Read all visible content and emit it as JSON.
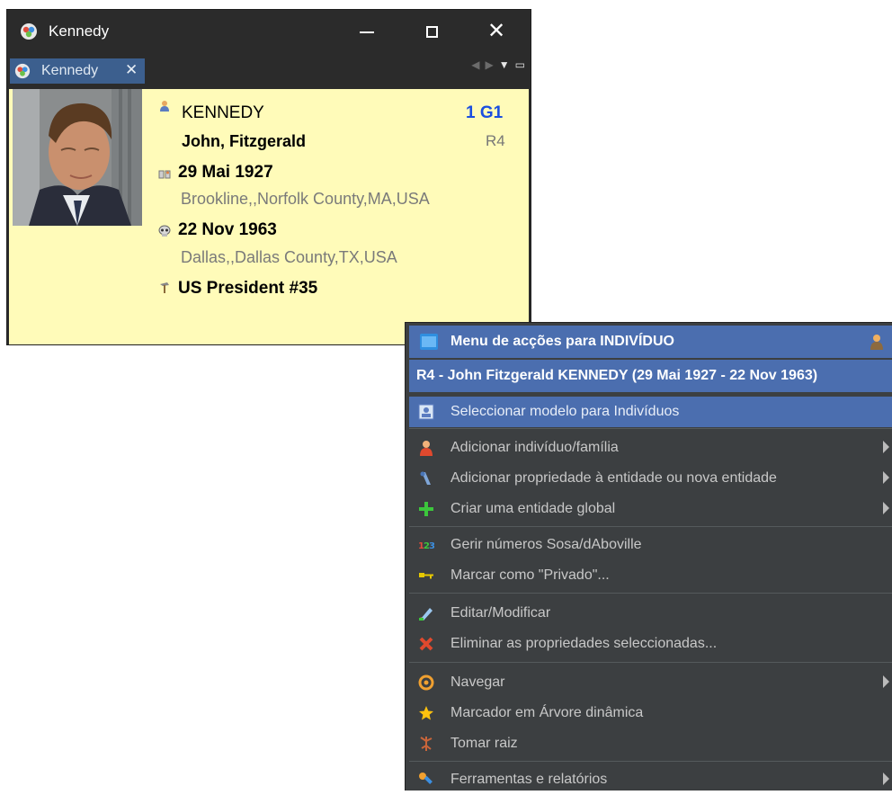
{
  "window": {
    "title": "Kennedy",
    "tab_label": "Kennedy"
  },
  "individual": {
    "surname": "KENNEDY",
    "given_names": "John, Fitzgerald",
    "generation": "1 G1",
    "ref": "R4",
    "birth_date": "29 Mai 1927",
    "birth_place": "Brookline,,Norfolk County,MA,USA",
    "death_date": "22 Nov 1963",
    "death_place": "Dallas,,Dallas County,TX,USA",
    "occupation": "US President #35"
  },
  "menu": {
    "header_title": "Menu de acções para INDIVÍDUO",
    "header_subtitle": "R4 - John Fitzgerald KENNEDY (29 Mai 1927 - 22 Nov 1963)",
    "items": [
      {
        "label": "Seleccionar modelo para Indivíduos",
        "icon": "template-icon",
        "submenu": false,
        "selected": true
      },
      {
        "label": "Adicionar indivíduo/família",
        "icon": "add-person-icon",
        "submenu": true
      },
      {
        "label": "Adicionar propriedade à entidade ou nova entidade",
        "icon": "add-property-icon",
        "submenu": true
      },
      {
        "label": "Criar uma entidade global",
        "icon": "plus-icon",
        "submenu": true
      },
      {
        "label": "Gerir números Sosa/dAboville",
        "icon": "numbers-icon",
        "submenu": false
      },
      {
        "label": "Marcar como \"Privado\"...",
        "icon": "key-icon",
        "submenu": false
      },
      {
        "label": "Editar/Modificar",
        "icon": "edit-icon",
        "submenu": false
      },
      {
        "label": "Eliminar as propriedades seleccionadas...",
        "icon": "delete-icon",
        "submenu": false
      },
      {
        "label": "Navegar",
        "icon": "navigate-icon",
        "submenu": true
      },
      {
        "label": "Marcador em Árvore dinâmica",
        "icon": "star-icon",
        "submenu": false
      },
      {
        "label": "Tomar raiz",
        "icon": "root-icon",
        "submenu": false
      },
      {
        "label": "Ferramentas e relatórios",
        "icon": "tools-icon",
        "submenu": true
      }
    ]
  },
  "colors": {
    "window_bg": "#2b2b2b",
    "panel_bg": "#fffbb9",
    "accent": "#4b6eaf",
    "menu_bg": "#3c3f41",
    "generation_text": "#1a4ee0"
  }
}
